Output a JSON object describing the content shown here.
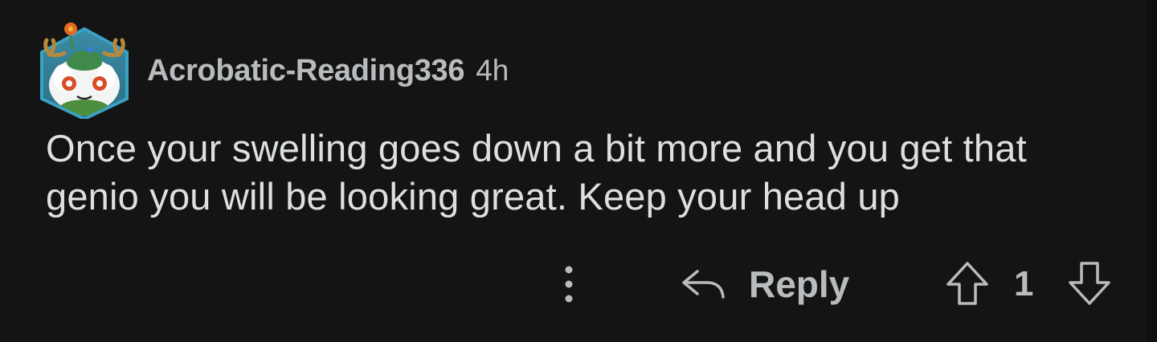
{
  "comment": {
    "author": "Acrobatic-Reading336",
    "age": "4h",
    "body": "Once your swelling goes down a bit more and you get that genio you will be looking great. Keep your head up",
    "avatar_icon": "snoo-avatar-icon"
  },
  "actions": {
    "more_icon": "kebab-menu-icon",
    "reply_icon": "reply-arrow-icon",
    "reply_label": "Reply",
    "upvote_icon": "upvote-arrow-icon",
    "score": "1",
    "downvote_icon": "downvote-arrow-icon"
  },
  "colors": {
    "background": "#141414",
    "text_primary": "#dde0e2",
    "text_secondary": "#b9bcbe",
    "avatar_frame": "#2c8fb1"
  }
}
